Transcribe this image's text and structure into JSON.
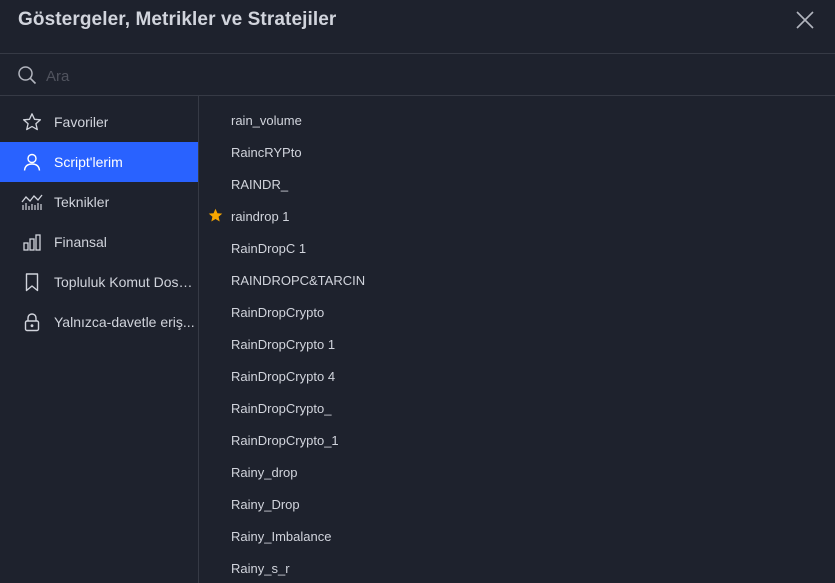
{
  "dialog": {
    "title": "Göstergeler, Metrikler ve Stratejiler"
  },
  "search": {
    "placeholder": "Ara"
  },
  "sidebar": {
    "items": [
      {
        "label": "Favoriler",
        "icon": "star-icon",
        "active": false
      },
      {
        "label": "Script'lerim",
        "icon": "user-icon",
        "active": true
      },
      {
        "label": "Teknikler",
        "icon": "chart-line-icon",
        "active": false
      },
      {
        "label": "Finansal",
        "icon": "bar-chart-icon",
        "active": false
      },
      {
        "label": "Topluluk Komut Dosy...",
        "icon": "bookmark-icon",
        "active": false
      },
      {
        "label": "Yalnızca-davetle eriş...",
        "icon": "lock-icon",
        "active": false
      }
    ]
  },
  "scripts": [
    {
      "name": "rain_volume",
      "favorite": false
    },
    {
      "name": "RaincRYPto",
      "favorite": false
    },
    {
      "name": "RAINDR_",
      "favorite": false
    },
    {
      "name": "raindrop 1",
      "favorite": true
    },
    {
      "name": "RainDropC 1",
      "favorite": false
    },
    {
      "name": "RAINDROPC&TARCIN",
      "favorite": false
    },
    {
      "name": "RainDropCrypto",
      "favorite": false
    },
    {
      "name": "RainDropCrypto 1",
      "favorite": false
    },
    {
      "name": "RainDropCrypto 4",
      "favorite": false
    },
    {
      "name": "RainDropCrypto_",
      "favorite": false
    },
    {
      "name": "RainDropCrypto_1",
      "favorite": false
    },
    {
      "name": "Rainy_drop",
      "favorite": false
    },
    {
      "name": "Rainy_Drop",
      "favorite": false
    },
    {
      "name": "Rainy_Imbalance",
      "favorite": false
    },
    {
      "name": "Rainy_s_r",
      "favorite": false
    }
  ],
  "colors": {
    "background": "#1e222d",
    "accent": "#2962ff",
    "favorite_star": "#f7a600",
    "divider": "#363a45"
  }
}
